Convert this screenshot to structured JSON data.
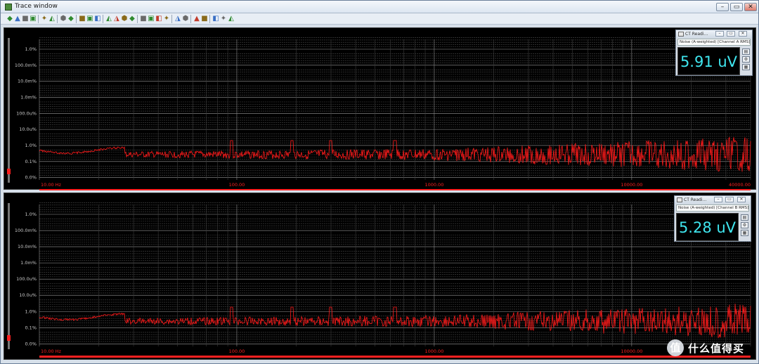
{
  "window": {
    "title": "Trace window",
    "controls": [
      "–",
      "▭",
      "✕"
    ]
  },
  "toolbar": {
    "icons": [
      "chart-add-icon",
      "chart-remove-icon",
      "save-icon",
      "copy-icon",
      "sep",
      "graph-green-icon",
      "graph-color-icon",
      "sep",
      "properties-icon",
      "grid-icon",
      "sep",
      "zoom-x-icon",
      "zoom-xy-icon",
      "zoom-fit-icon",
      "sep",
      "cursor-green-icon",
      "cursor-peak-icon",
      "cursor-track-icon",
      "cursor-flag-icon",
      "sep",
      "marker-left-icon",
      "marker-right-icon",
      "marker-set-icon",
      "marker-clear-icon",
      "sep",
      "measure-icon",
      "measure-alt-icon",
      "sep",
      "hardware-icon",
      "arrows-icon",
      "sep",
      "star-icon",
      "chart-check-icon",
      "chart-view-icon"
    ]
  },
  "panels": [
    {
      "id": "channel-a",
      "y_labels": [
        "1.0%",
        "100.0m%",
        "10.0m%",
        "1.0m%",
        "100.0u%",
        "10.0u%",
        "1.0%",
        "0.1%",
        "0.0%"
      ],
      "x_labels": [
        "10.00 Hz",
        "100.00",
        "1000.00",
        "10000.00",
        "40000.00"
      ],
      "reading": {
        "window_title": "CT Readi...",
        "subtitle": "Noise (A-weighted) [Channel A RMS]",
        "value": "5.91 uV"
      }
    },
    {
      "id": "channel-b",
      "y_labels": [
        "1.0%",
        "100.0m%",
        "10.0m%",
        "1.0m%",
        "100.0u%",
        "10.0u%",
        "1.0%",
        "0.1%",
        "0.0%"
      ],
      "x_labels": [
        "10.00 Hz",
        "100.00",
        "1000.00",
        "10000.00"
      ],
      "reading": {
        "window_title": "CT Readi...",
        "subtitle": "Noise (A-weighted) [Channel B RMS]",
        "value": "5.28 uV"
      }
    }
  ],
  "watermark": {
    "logo": "值",
    "text": "什么值得买"
  },
  "colors": {
    "trace": "#ff1a1a",
    "reading_value": "#3fe6ef",
    "grid": "#5a5a5a"
  }
}
